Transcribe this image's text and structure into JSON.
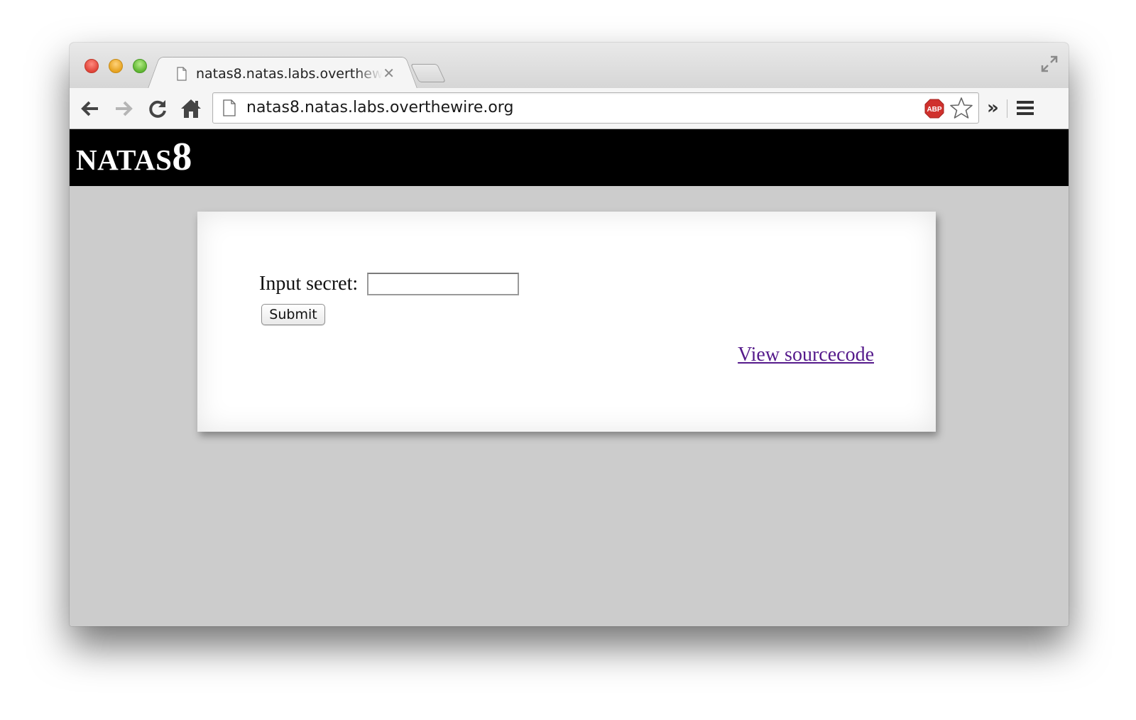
{
  "browser": {
    "tab": {
      "title": "natas8.natas.labs.overthewire.org",
      "close_glyph": "✕"
    },
    "address_bar": {
      "url": "natas8.natas.labs.overthewire.org"
    },
    "toolbar": {
      "extensions_overflow": "»",
      "adblock_label": "ABP"
    },
    "icons": {
      "back": "back-arrow-icon",
      "forward": "forward-arrow-icon",
      "reload": "reload-icon",
      "home": "home-icon",
      "page": "page-icon",
      "adblock": "adblock-icon",
      "bookmark": "star-icon",
      "menu": "hamburger-menu-icon",
      "fullscreen": "fullscreen-icon"
    }
  },
  "page": {
    "header": {
      "title_text": "NATAS",
      "title_number": "8"
    },
    "form": {
      "label": "Input secret:",
      "input_value": "",
      "submit_label": "Submit"
    },
    "source_link": "View sourcecode"
  },
  "colors": {
    "page_background": "#cccccc",
    "header_background": "#000000",
    "link_visited": "#551a8b"
  }
}
